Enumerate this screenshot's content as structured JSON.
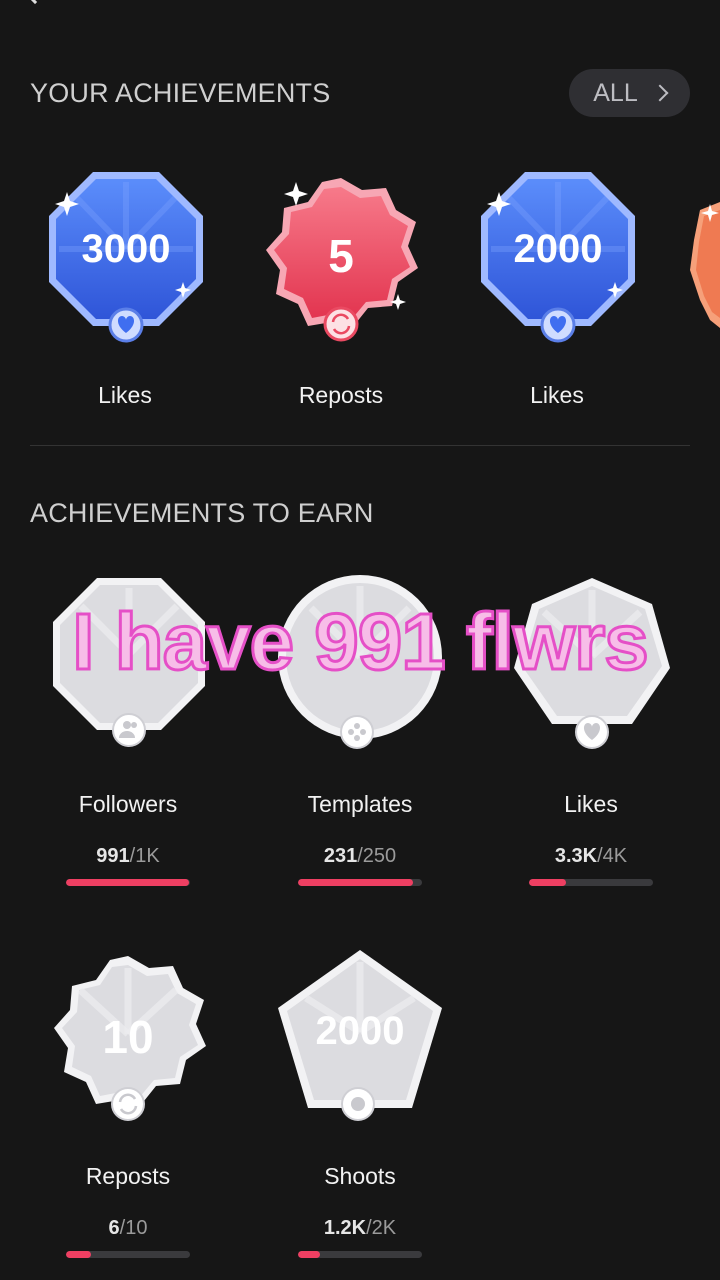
{
  "header": {
    "your_title": "YOUR ACHIEVEMENTS",
    "all_label": "ALL",
    "earn_title": "ACHIEVEMENTS TO EARN"
  },
  "earned": [
    {
      "number": "3000",
      "label": "Likes",
      "color": "#3f6ef0",
      "icon": "heart-icon"
    },
    {
      "number": "5",
      "label": "Reposts",
      "color": "#ea4a62",
      "icon": "repost-icon"
    },
    {
      "number": "2000",
      "label": "Likes",
      "color": "#3f6ef0",
      "icon": "heart-icon"
    }
  ],
  "to_earn": [
    {
      "label": "Followers",
      "current": "991",
      "total": "1K",
      "progress": 0.991,
      "icon": "followers-icon"
    },
    {
      "label": "Templates",
      "current": "231",
      "total": "250",
      "progress": 0.924,
      "icon": "templates-icon"
    },
    {
      "label": "Likes",
      "current": "3.3K",
      "total": "4K",
      "progress": 0.3,
      "icon": "heart-icon"
    },
    {
      "number": "10",
      "label": "Reposts",
      "current": "6",
      "total": "10",
      "progress": 0.2,
      "icon": "repost-icon"
    },
    {
      "number": "2000",
      "label": "Shoots",
      "current": "1.2K",
      "total": "2K",
      "progress": 0.18,
      "icon": "shoot-icon"
    }
  ],
  "overlay_text": "I have 991 flwrs",
  "colors": {
    "progress_fill": "#ee3f62",
    "likes_badge": "#3f6ef0",
    "repost_badge": "#ea4a62"
  }
}
